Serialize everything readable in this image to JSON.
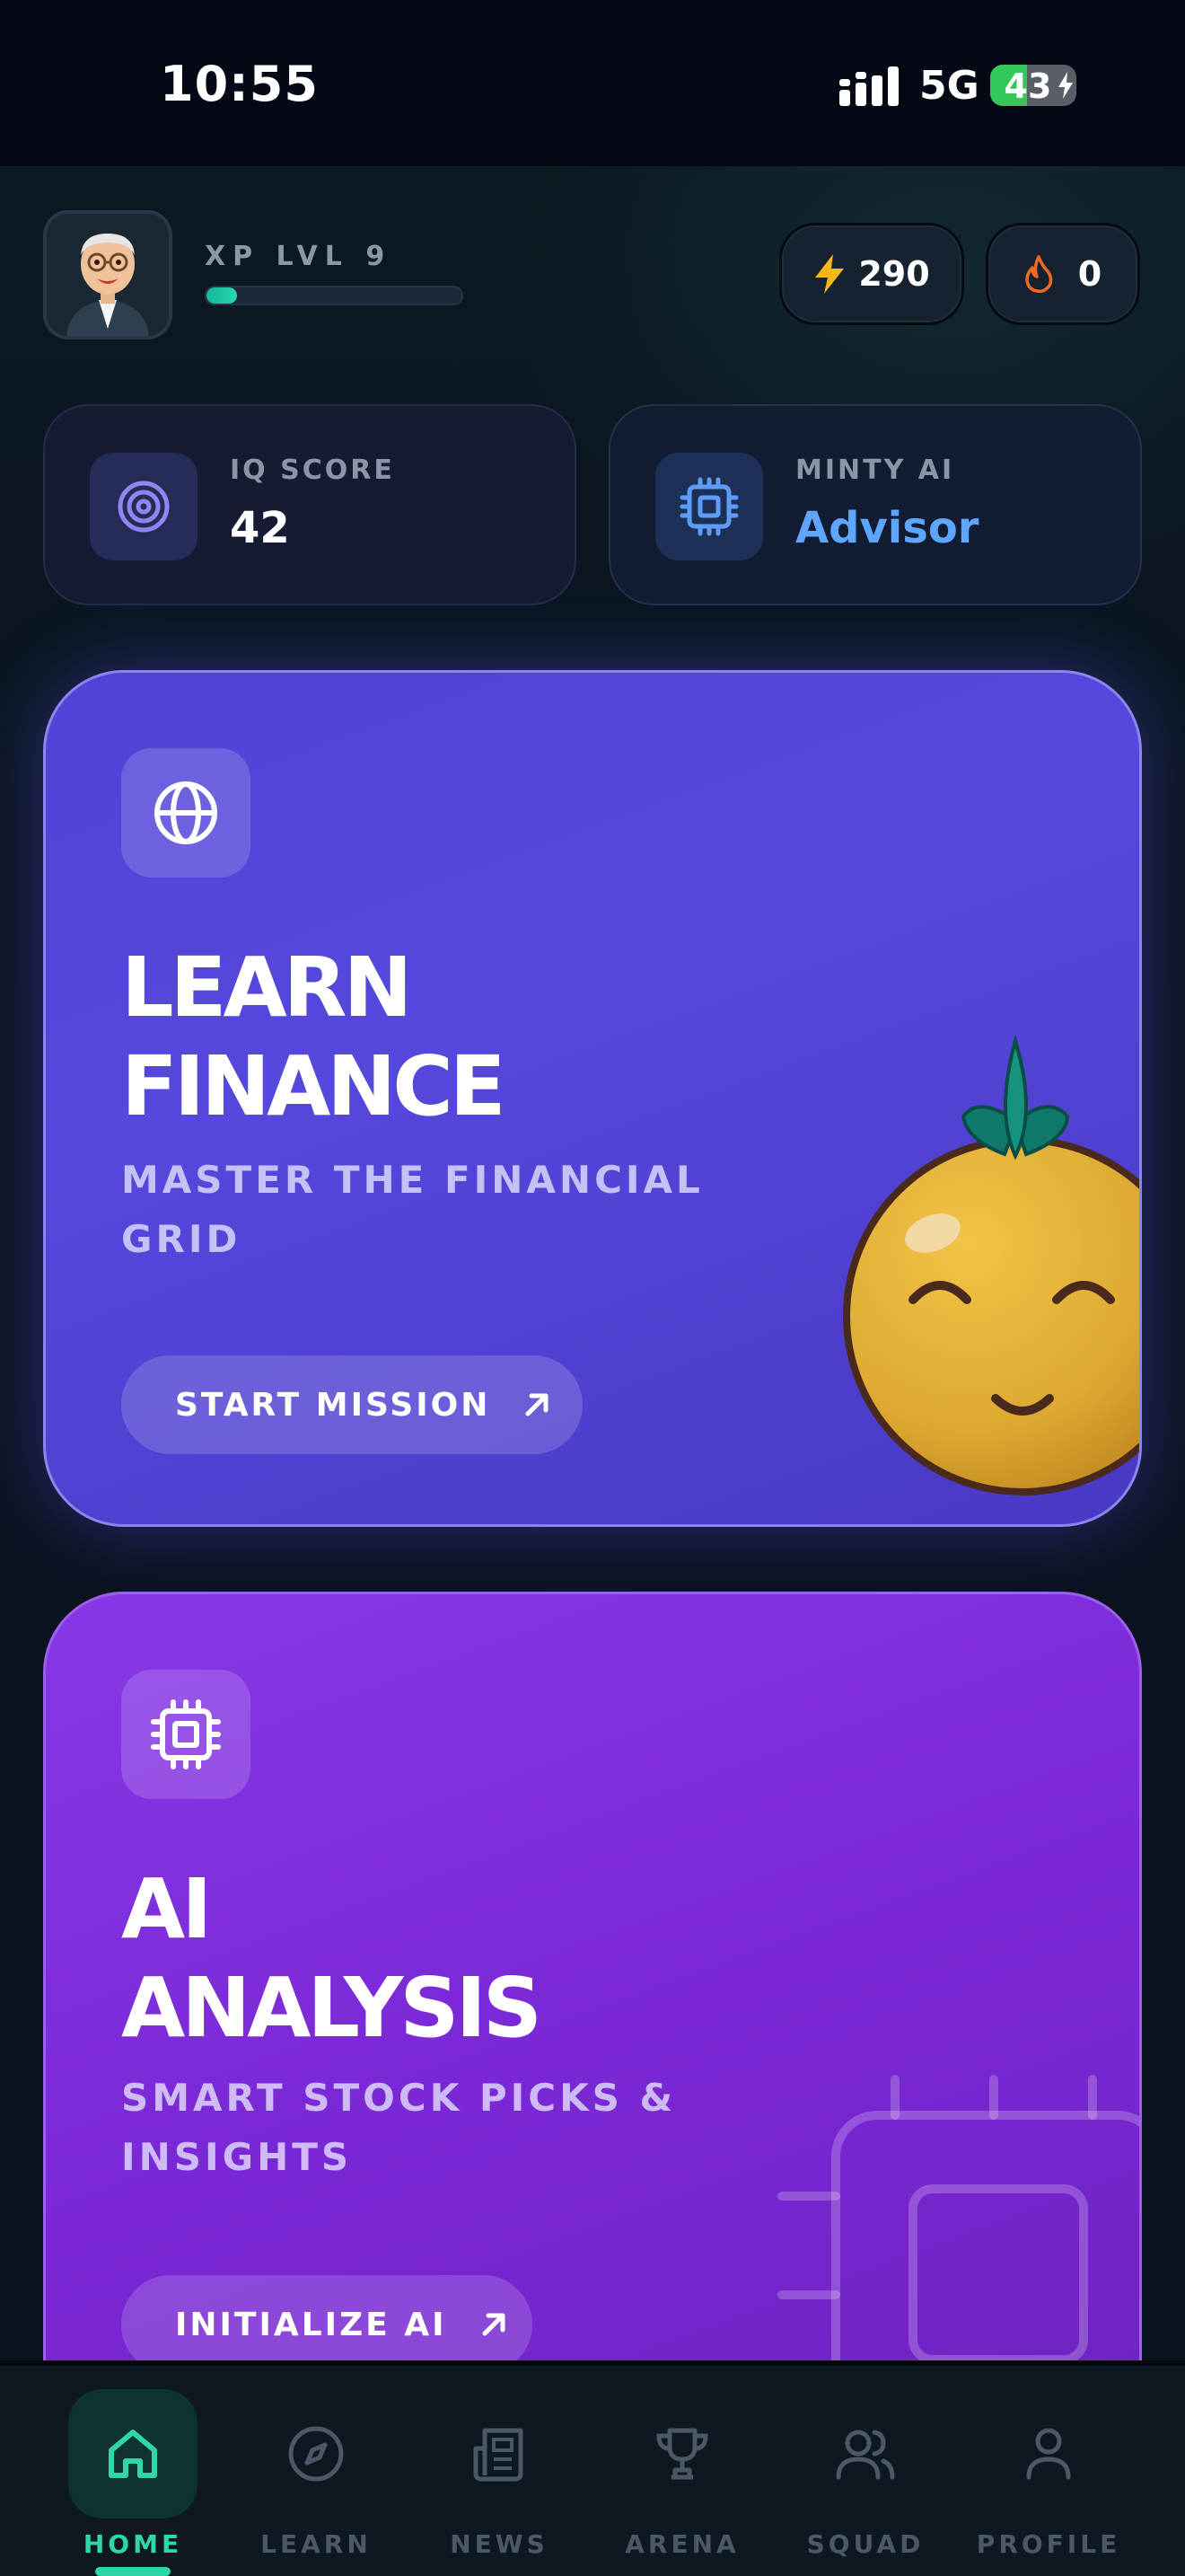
{
  "status_bar": {
    "time": "10:55",
    "network": "5G",
    "battery": "43",
    "battery_level": 0.43
  },
  "header": {
    "xp_label": "XP LVL 9",
    "xp_progress": 0.12,
    "energy_value": "290",
    "streak_value": "0",
    "energy_icon": "lightning-bolt-icon",
    "streak_icon": "flame-icon"
  },
  "stats": {
    "iq": {
      "label": "IQ SCORE",
      "value": "42",
      "icon": "target-icon"
    },
    "ai": {
      "label": "MINTY AI",
      "value": "Advisor",
      "icon": "chip-icon"
    }
  },
  "cards": {
    "finance": {
      "title_line1": "LEARN",
      "title_line2": "FINANCE",
      "subtitle": "MASTER THE FINANCIAL GRID",
      "cta": "START MISSION",
      "icon": "globe-icon"
    },
    "ai": {
      "title_line1": "AI",
      "title_line2": "ANALYSIS",
      "subtitle": "SMART STOCK PICKS & INSIGHTS",
      "cta": "INITIALIZE AI",
      "icon": "chip-icon"
    }
  },
  "nav": {
    "items": [
      {
        "label": "HOME",
        "icon": "home-icon",
        "active": true
      },
      {
        "label": "LEARN",
        "icon": "compass-icon",
        "active": false
      },
      {
        "label": "NEWS",
        "icon": "newspaper-icon",
        "active": false
      },
      {
        "label": "ARENA",
        "icon": "trophy-icon",
        "active": false
      },
      {
        "label": "SQUAD",
        "icon": "users-icon",
        "active": false
      },
      {
        "label": "PROFILE",
        "icon": "user-icon",
        "active": false
      }
    ]
  },
  "colors": {
    "accent": "#2fd6a8",
    "finance_card": "#5143d6",
    "ai_card": "#8838e6",
    "advisor_text": "#5ea6ff"
  }
}
